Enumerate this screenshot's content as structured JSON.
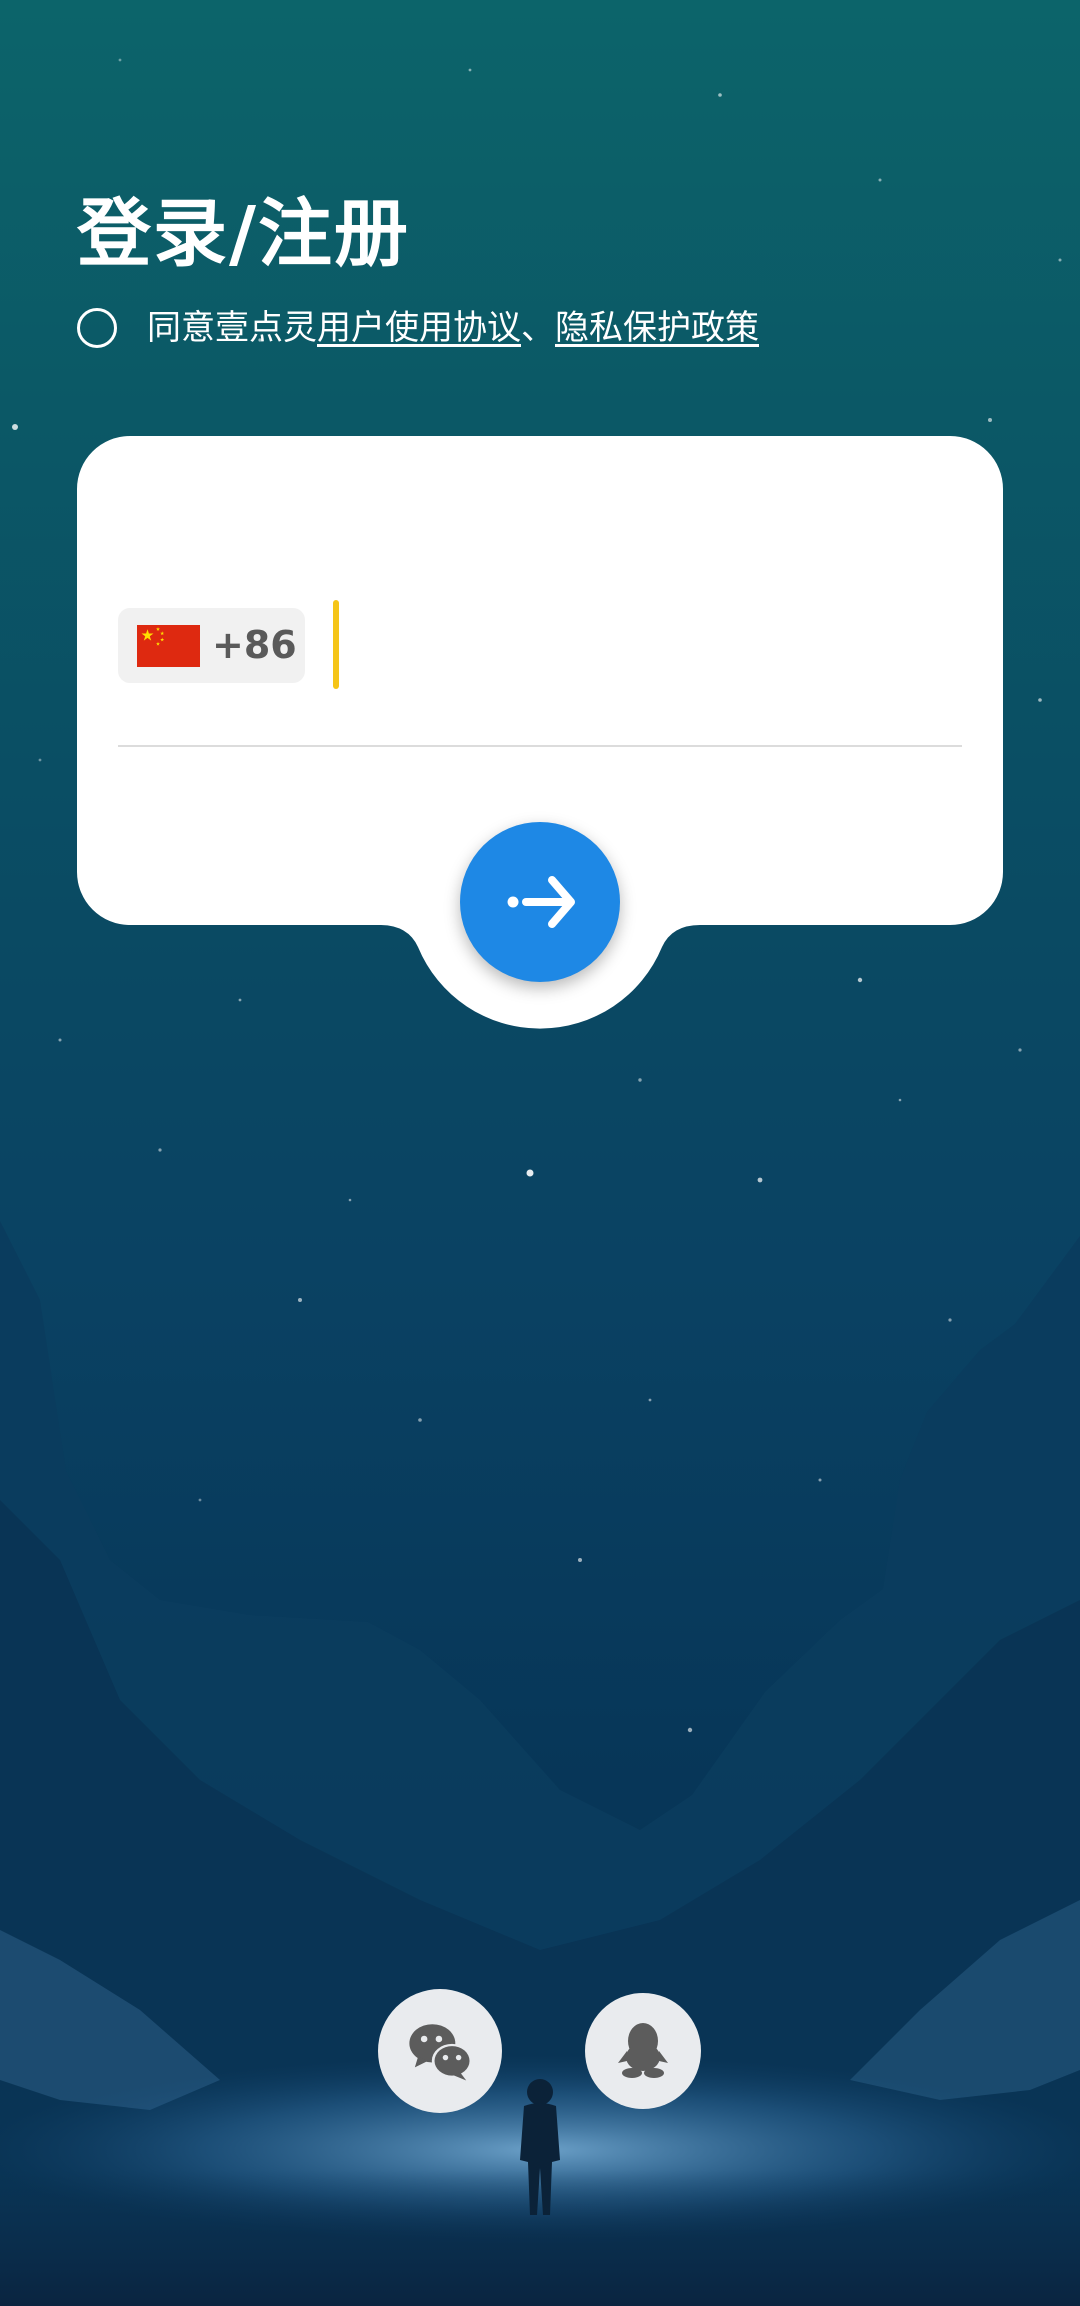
{
  "header": {
    "title": "登录/注册"
  },
  "agreement": {
    "checked": false,
    "prefix": "同意壹点灵",
    "user_agreement": "用户使用协议",
    "separator": "、",
    "privacy_policy": "隐私保护政策"
  },
  "login_card": {
    "country_flag": "china-flag-icon",
    "country_code": "+86",
    "phone_number": "",
    "submit_icon": "arrow-right-icon"
  },
  "social_login": [
    {
      "icon": "wechat-icon"
    },
    {
      "icon": "qq-icon"
    }
  ],
  "colors": {
    "accent": "#1e88e5",
    "cursor": "#f5c518",
    "card": "#ffffff",
    "social_button": "#e9ebee"
  }
}
